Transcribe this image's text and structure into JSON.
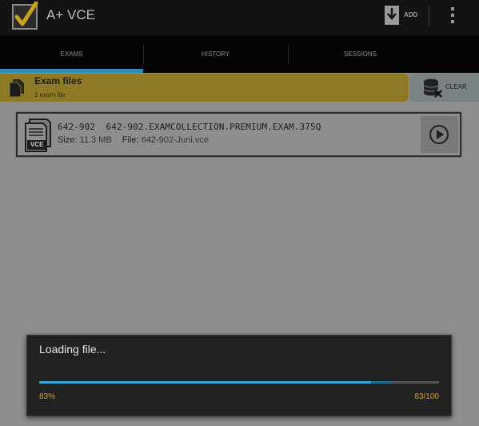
{
  "app": {
    "title": "A+ VCE"
  },
  "actionbar": {
    "add_label": "ADD"
  },
  "tabs": [
    {
      "label": "EXAMS",
      "active": true
    },
    {
      "label": "HISTORY",
      "active": false
    },
    {
      "label": "SESSIONS",
      "active": false
    }
  ],
  "files_header": {
    "title": "Exam files",
    "count": "1 exam file",
    "clear_label": "CLEAR"
  },
  "exam": {
    "code": "642-902",
    "name": "642-902.EXAMCOLLECTION.PREMIUM.EXAM.375Q",
    "size_label": "Size:",
    "size": "11.3 MB",
    "file_label": "File:",
    "file": "642-902-Juni.vce",
    "icon_text": "VCE"
  },
  "dialog": {
    "message": "Loading file...",
    "percent_text": "83%",
    "count_text": "83/100",
    "progress": 0.83,
    "secondary_progress": 0.88
  },
  "colors": {
    "accent": "#2e8db8",
    "progress": "#2fa9e0",
    "highlight_text": "#d9a324",
    "header_yellow": "#8e7a24",
    "background": "#8e8e8e"
  },
  "icons": {
    "app": "checkmark-logo-icon",
    "add": "download-icon",
    "overflow": "overflow-menu-icon",
    "files": "documents-icon",
    "clear": "database-clear-icon",
    "exam": "vce-file-icon",
    "play": "play-icon"
  }
}
